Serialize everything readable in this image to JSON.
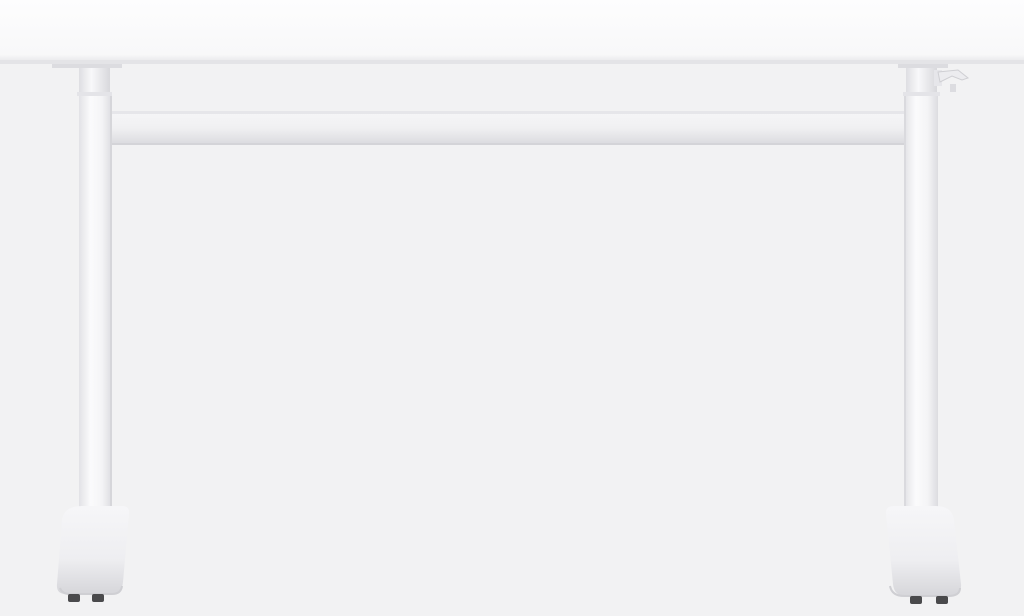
{
  "image": {
    "subject": "white-height-adjustable-desk",
    "colors": {
      "background": "#f2f2f3",
      "tabletop": "#fbfbfc",
      "tabletop_edge": "#e4e4e7",
      "frame": "#f4f4f6",
      "frame_shadow": "#d9d9dd",
      "frame_highlight": "#ffffff",
      "glide": "#4a4a4c"
    },
    "parts": [
      "tabletop",
      "crossbar",
      "left-leg",
      "right-leg",
      "left-foot",
      "right-foot",
      "crank-handle"
    ]
  }
}
